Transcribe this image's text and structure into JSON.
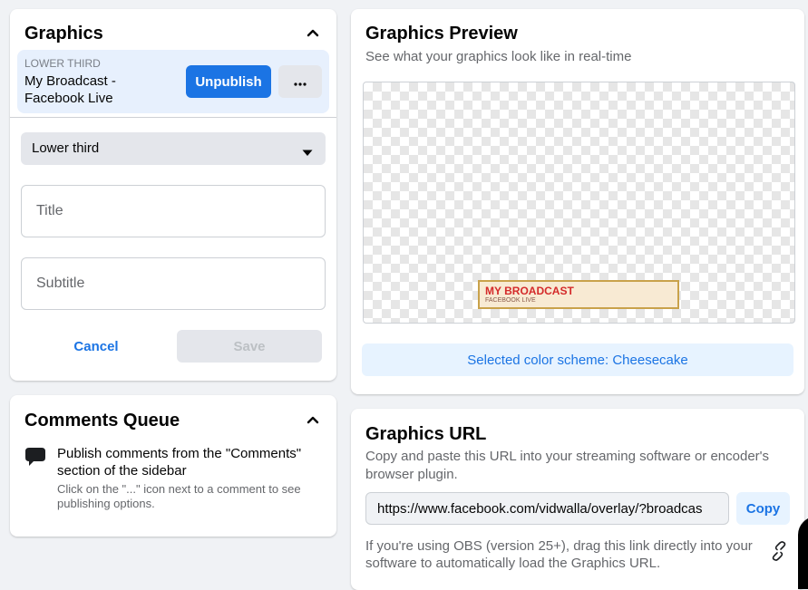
{
  "graphics_panel": {
    "title": "Graphics",
    "collapse_icon": "chevron-up-icon",
    "published_item": {
      "type_label": "LOWER THIRD",
      "name": "My Broadcast - Facebook Live",
      "unpublish_label": "Unpublish",
      "more_icon": "more-horizontal-icon"
    },
    "graphic_type_select": {
      "selected": "Lower third",
      "caret_icon": "caret-down-icon"
    },
    "title_input": {
      "placeholder": "Title",
      "value": ""
    },
    "subtitle_input": {
      "placeholder": "Subtitle",
      "value": ""
    },
    "cancel_label": "Cancel",
    "save_label": "Save"
  },
  "comments_queue": {
    "title": "Comments Queue",
    "collapse_icon": "chevron-up-icon",
    "icon": "comment-bubble-icon",
    "main_text": "Publish comments from the \"Comments\" section of the sidebar",
    "sub_text": "Click on the \"...\" icon next to a comment to see publishing options."
  },
  "preview": {
    "title": "Graphics Preview",
    "subtitle": "See what your graphics look like in real-time",
    "lower_third": {
      "title": "MY BROADCAST",
      "subtitle": "FACEBOOK LIVE",
      "colors": {
        "background": "#f8ead3",
        "border": "#c9a24b",
        "title": "#d42a2a",
        "subtitle": "#8a5a4a"
      }
    },
    "color_scheme_label": "Selected color scheme: Cheesecake"
  },
  "graphics_url": {
    "title": "Graphics URL",
    "description": "Copy and paste this URL into your streaming software or encoder's browser plugin.",
    "url_value": "https://www.facebook.com/vidwalla/overlay/?broadcas",
    "copy_label": "Copy",
    "obs_text": "If you're using OBS (version 25+), drag this link directly into your software to automatically load the Graphics URL.",
    "link_icon": "link-icon"
  },
  "colors": {
    "accent": "#1b74e4",
    "page_background": "#f0f2f5",
    "published_row_bg": "#e7f0fd",
    "secondary_button_bg": "#e4e6eb",
    "muted_text": "#65676b"
  }
}
